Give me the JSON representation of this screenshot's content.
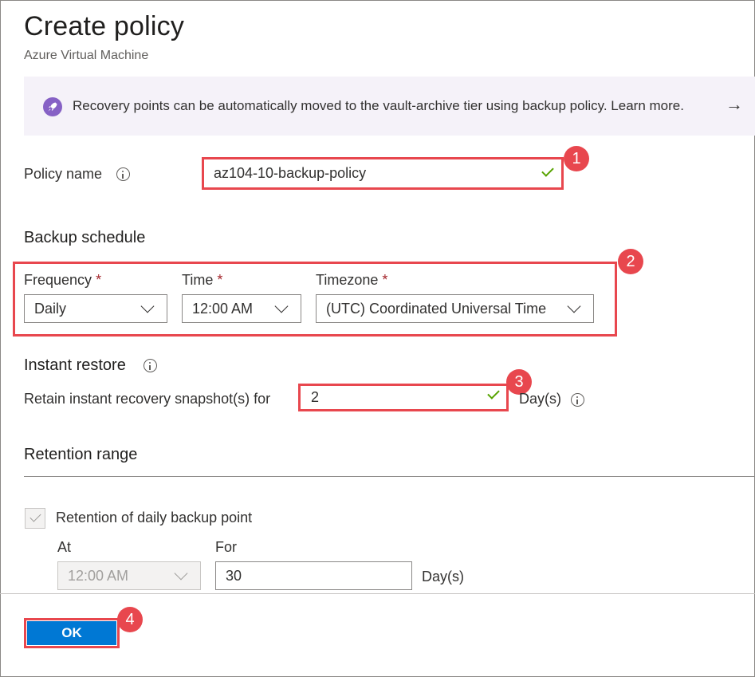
{
  "header": {
    "title": "Create policy",
    "subtitle": "Azure Virtual Machine"
  },
  "banner": {
    "text": "Recovery points can be automatically moved to the vault-archive tier using backup policy. Learn more.",
    "arrow": "→"
  },
  "policy_name": {
    "label": "Policy name",
    "value": "az104-10-backup-policy"
  },
  "backup_schedule": {
    "heading": "Backup schedule",
    "frequency": {
      "label": "Frequency",
      "value": "Daily"
    },
    "time": {
      "label": "Time",
      "value": "12:00 AM"
    },
    "timezone": {
      "label": "Timezone",
      "value": "(UTC) Coordinated Universal Time"
    },
    "required_marker": "*"
  },
  "instant_restore": {
    "heading": "Instant restore",
    "retain_label": "Retain instant recovery snapshot(s) for",
    "value": "2",
    "unit": "Day(s)"
  },
  "retention_range": {
    "heading": "Retention range",
    "daily_label": "Retention of daily backup point",
    "at_label": "At",
    "at_value": "12:00 AM",
    "for_label": "For",
    "for_value": "30",
    "unit": "Day(s)"
  },
  "footer": {
    "ok_label": "OK"
  },
  "callouts": [
    "1",
    "2",
    "3",
    "4"
  ],
  "colors": {
    "accent": "#0078d4",
    "callout": "#e8474e",
    "banner_bg": "#f5f2f9",
    "banner_icon": "#8661c5",
    "valid": "#57a300"
  }
}
